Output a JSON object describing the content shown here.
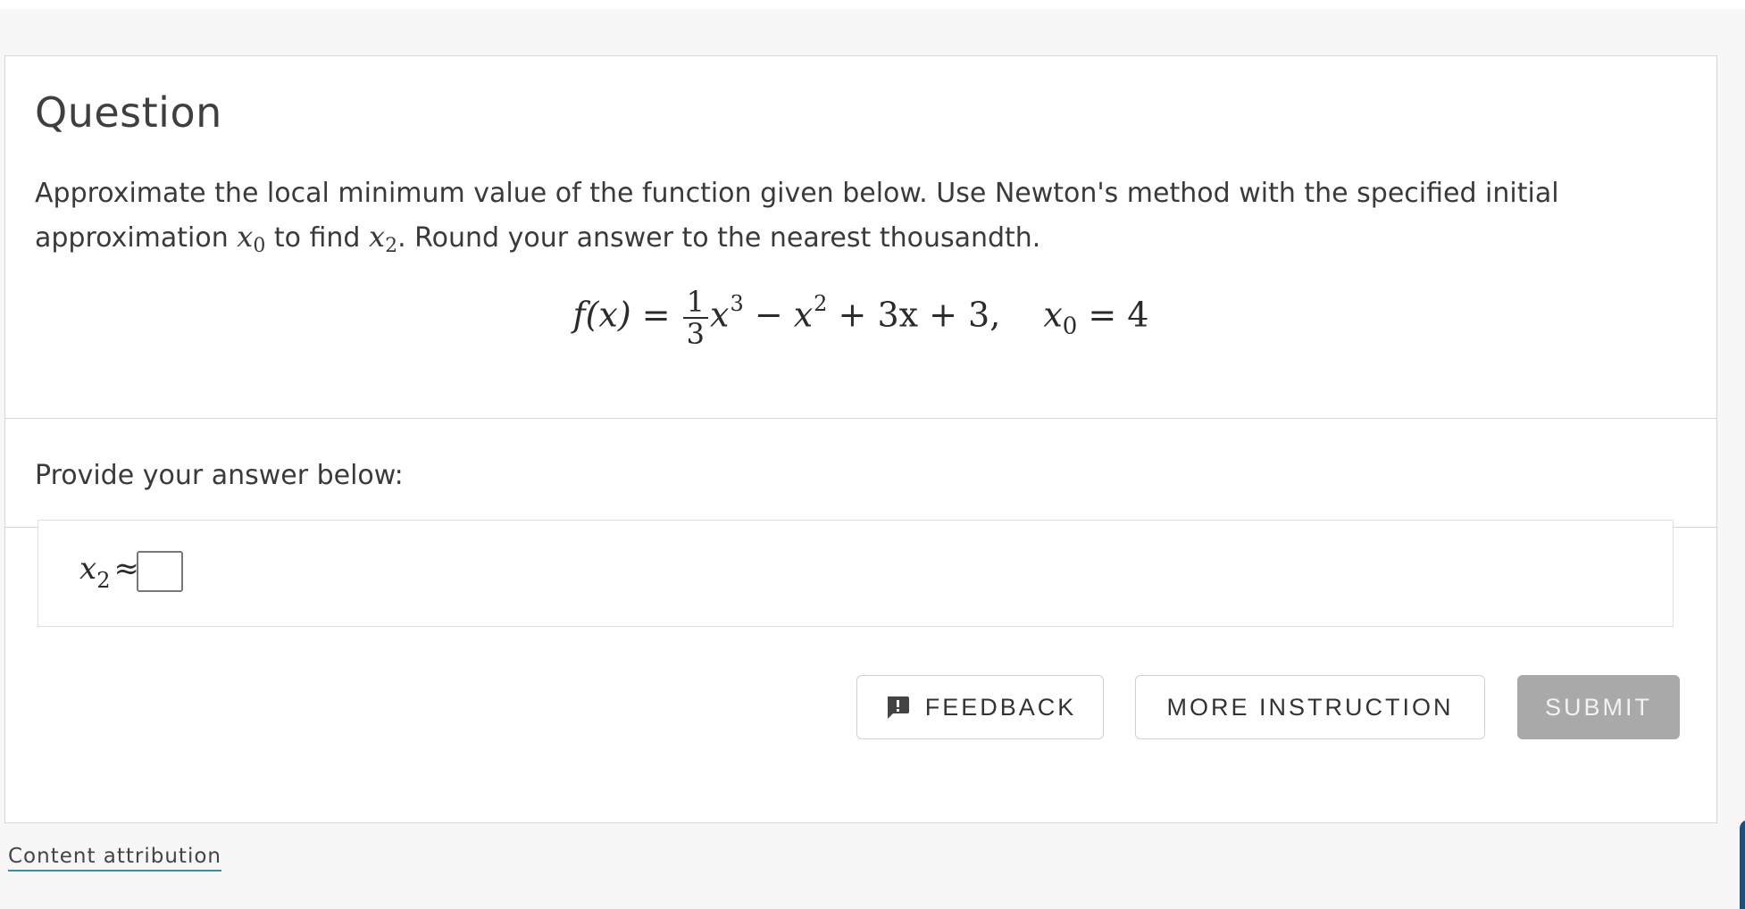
{
  "question": {
    "title": "Question",
    "text_part1": "Approximate the local minimum value of the function given below. Use Newton's method with the specified initial approximation ",
    "x0_var": "x",
    "x0_sub": "0",
    "text_part2": " to find ",
    "x2_var": "x",
    "x2_sub": "2",
    "text_part3": ". Round your answer to the nearest thousandth.",
    "formula": {
      "lhs": "f(x) = ",
      "frac_num": "1",
      "frac_den": "3",
      "term1_var": "x",
      "term1_exp": "3",
      "term2": " − x",
      "term2_exp": "2",
      "term3": " + 3x + 3,",
      "x0_var": "x",
      "x0_sub": "0",
      "x0_value": " = 4"
    }
  },
  "answer": {
    "prompt": "Provide your answer below:",
    "lhs_var": "x",
    "lhs_sub": "2",
    "approx_symbol": "≈",
    "input_value": ""
  },
  "buttons": {
    "feedback": "FEEDBACK",
    "more_instruction": "MORE INSTRUCTION",
    "submit": "SUBMIT"
  },
  "footer": {
    "attribution": "Content attribution"
  },
  "colors": {
    "submit_bg": "#a9a9a9",
    "attribution_underline": "#3a8f9a"
  }
}
